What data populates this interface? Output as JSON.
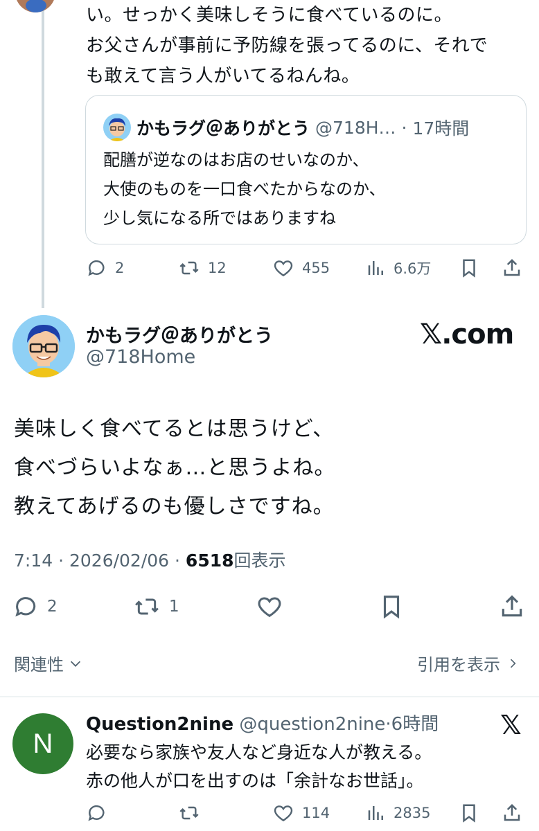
{
  "prev_tweet": {
    "text_lines": [
      "い。せっかく美味しそうに食べているのに。",
      "お父さんが事前に予防線を張ってるのに、それで",
      "も敢えて言う人がいてるねんね。"
    ],
    "quote": {
      "name": "かもラグ＠ありがとう",
      "handle": "@718H…",
      "sep": "·",
      "time": "17時間",
      "lines": [
        "配膳が逆なのはお店のせいなのか、",
        "大使のものを一口食べたからなのか、",
        "少し気になる所ではありますね"
      ]
    },
    "actions": {
      "replies": "2",
      "reposts": "12",
      "likes": "455",
      "views": "6.6万"
    }
  },
  "main_tweet": {
    "name": "かもラグ＠ありがとう",
    "handle": "@718Home",
    "brand": "𝕏.com",
    "body_lines": [
      "美味しく食べてるとは思うけど、",
      "食べづらいよなぁ…と思うよね。",
      "教えてあげるのも優しさですね。"
    ],
    "timestamp": "7:14 · 2026/02/06 · ",
    "views_count": "6518",
    "views_label": "回表示",
    "actions": {
      "replies": "2",
      "reposts": "1"
    }
  },
  "relevance": {
    "label": "関連性",
    "quotes_label": "引用を表示"
  },
  "reply": {
    "avatar_letter": "N",
    "name": "Question2nine",
    "handle": "@question2nine",
    "sep": "·",
    "time": "6時間",
    "lines": [
      "必要なら家族や友人など身近な人が教える。",
      "赤の他人が口を出すのは「余計なお世話」。"
    ],
    "actions": {
      "likes": "114",
      "views": "2835"
    },
    "x_logo": "𝕏"
  },
  "colors": {
    "text": "#0f1419",
    "secondary": "#536471",
    "border": "#cfd9de",
    "reply_avatar": "#2f7d32"
  }
}
